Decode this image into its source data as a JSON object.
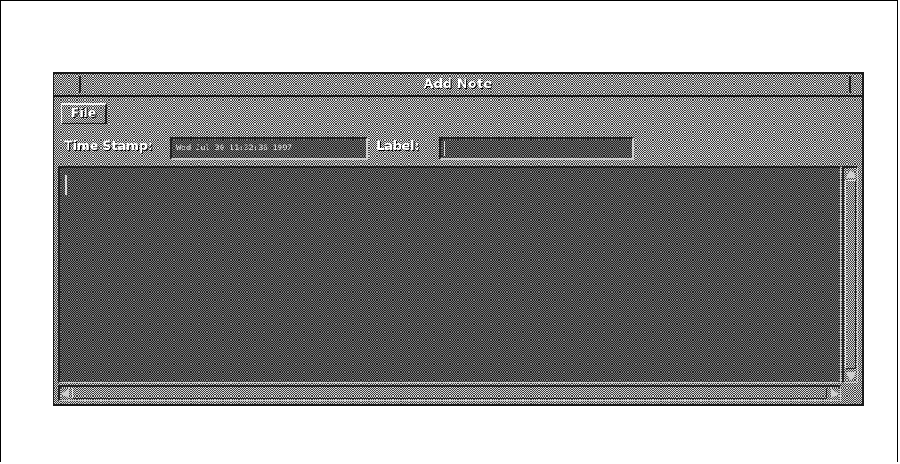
{
  "window": {
    "title": "Add Note"
  },
  "menubar": {
    "file_label": "File"
  },
  "fields": {
    "timestamp_label": "Time Stamp:",
    "timestamp_value": "Wed Jul 30 11:32:36 1997",
    "label_label": "Label:",
    "label_value": ""
  },
  "note_text": {
    "value": ""
  },
  "colors": {
    "window_face": "#9a9a9a",
    "field_background": "#555555",
    "text": "#ffffff"
  },
  "icons": {
    "system_menu": "window-menu-icon",
    "scroll_up": "arrow-up-icon",
    "scroll_down": "arrow-down-icon",
    "scroll_left": "arrow-left-icon",
    "scroll_right": "arrow-right-icon"
  }
}
